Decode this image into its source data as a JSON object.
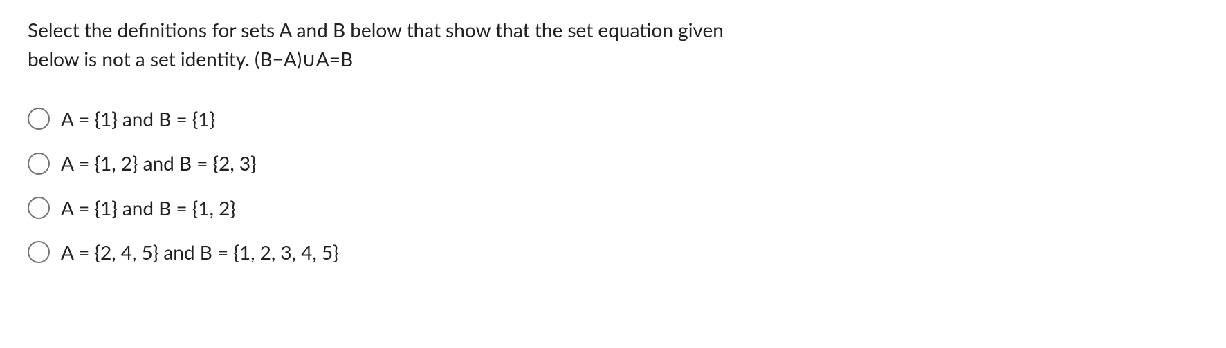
{
  "question": {
    "line1": "Select the definitions for sets A and B below that show that the set equation given",
    "line2": "below is not a set identity. (B−A)∪A=B"
  },
  "options": [
    {
      "label": "A = {1} and B = {1}"
    },
    {
      "label": "A = {1, 2} and B = {2, 3}"
    },
    {
      "label": "A = {1} and B = {1, 2}"
    },
    {
      "label": "A = {2, 4, 5} and B = {1, 2, 3, 4, 5}"
    }
  ]
}
